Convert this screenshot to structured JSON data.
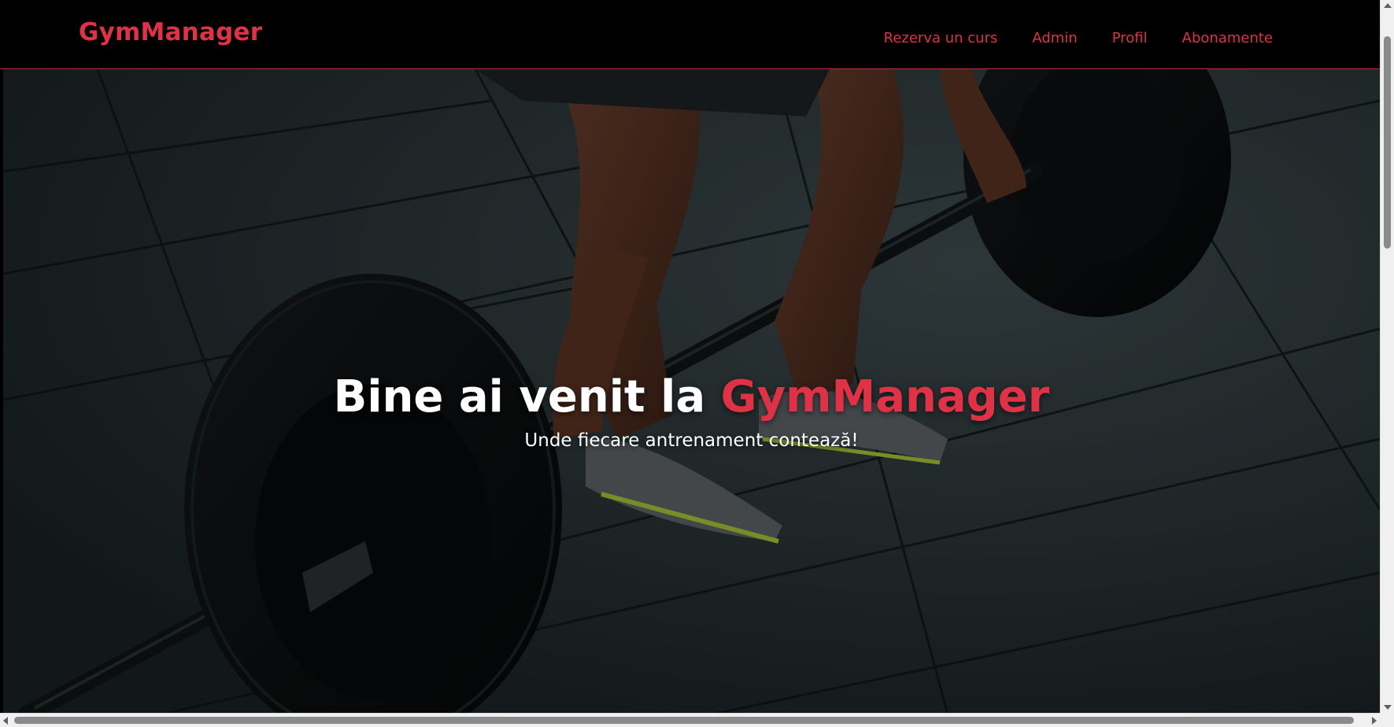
{
  "navbar": {
    "brand": "GymManager",
    "links": [
      {
        "label": "Rezerva un curs"
      },
      {
        "label": "Admin"
      },
      {
        "label": "Profil"
      },
      {
        "label": "Abonamente"
      }
    ]
  },
  "hero": {
    "title_prefix": "Bine ai venit la ",
    "title_accent": "GymManager",
    "subtitle": "Unde fiecare antrenament contează!",
    "image_description_icon": "barbell-deadlift-photo"
  },
  "colors": {
    "accent": "#e03246",
    "navbar_bg": "#000000",
    "hero_text": "#ffffff"
  }
}
